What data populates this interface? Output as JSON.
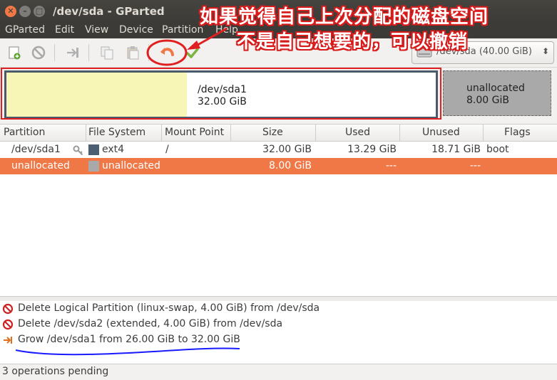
{
  "window": {
    "title": "/dev/sda - GParted"
  },
  "menubar": {
    "items": [
      "GParted",
      "Edit",
      "View",
      "Device",
      "Partition",
      "Help"
    ]
  },
  "device_selector": {
    "value": "/dev/sda   (40.00 GiB)"
  },
  "disk_map": {
    "partition": {
      "name": "/dev/sda1",
      "size": "32.00 GiB",
      "used_fraction": 0.42
    },
    "unallocated": {
      "name": "unallocated",
      "size": "8.00 GiB"
    }
  },
  "table": {
    "headers": [
      "Partition",
      "File System",
      "Mount Point",
      "Size",
      "Used",
      "Unused",
      "Flags"
    ],
    "rows": [
      {
        "partition": "/dev/sda1",
        "filesystem": "ext4",
        "mount": "/",
        "size": "32.00 GiB",
        "used": "13.29 GiB",
        "unused": "18.71 GiB",
        "flags": "boot",
        "color": "#4a6072"
      },
      {
        "partition": "unallocated",
        "filesystem": "unallocated",
        "mount": "",
        "size": "8.00 GiB",
        "used": "---",
        "unused": "---",
        "flags": "",
        "color": "#a9a9a9"
      }
    ]
  },
  "operations": [
    {
      "type": "delete",
      "text": "Delete Logical Partition (linux-swap, 4.00 GiB) from /dev/sda"
    },
    {
      "type": "delete",
      "text": "Delete /dev/sda2 (extended, 4.00 GiB) from /dev/sda"
    },
    {
      "type": "grow",
      "text": "Grow /dev/sda1 from 26.00 GiB to 32.00 GiB"
    }
  ],
  "status": {
    "text": "3 operations pending"
  },
  "annotation": {
    "line1": "如果觉得自己上次分配的磁盘空间",
    "line2": "不是自己想要的，可以撤销"
  },
  "colors": {
    "accent": "#f07746",
    "annot_red": "#e02020",
    "annot_blue": "#1a1aff"
  }
}
